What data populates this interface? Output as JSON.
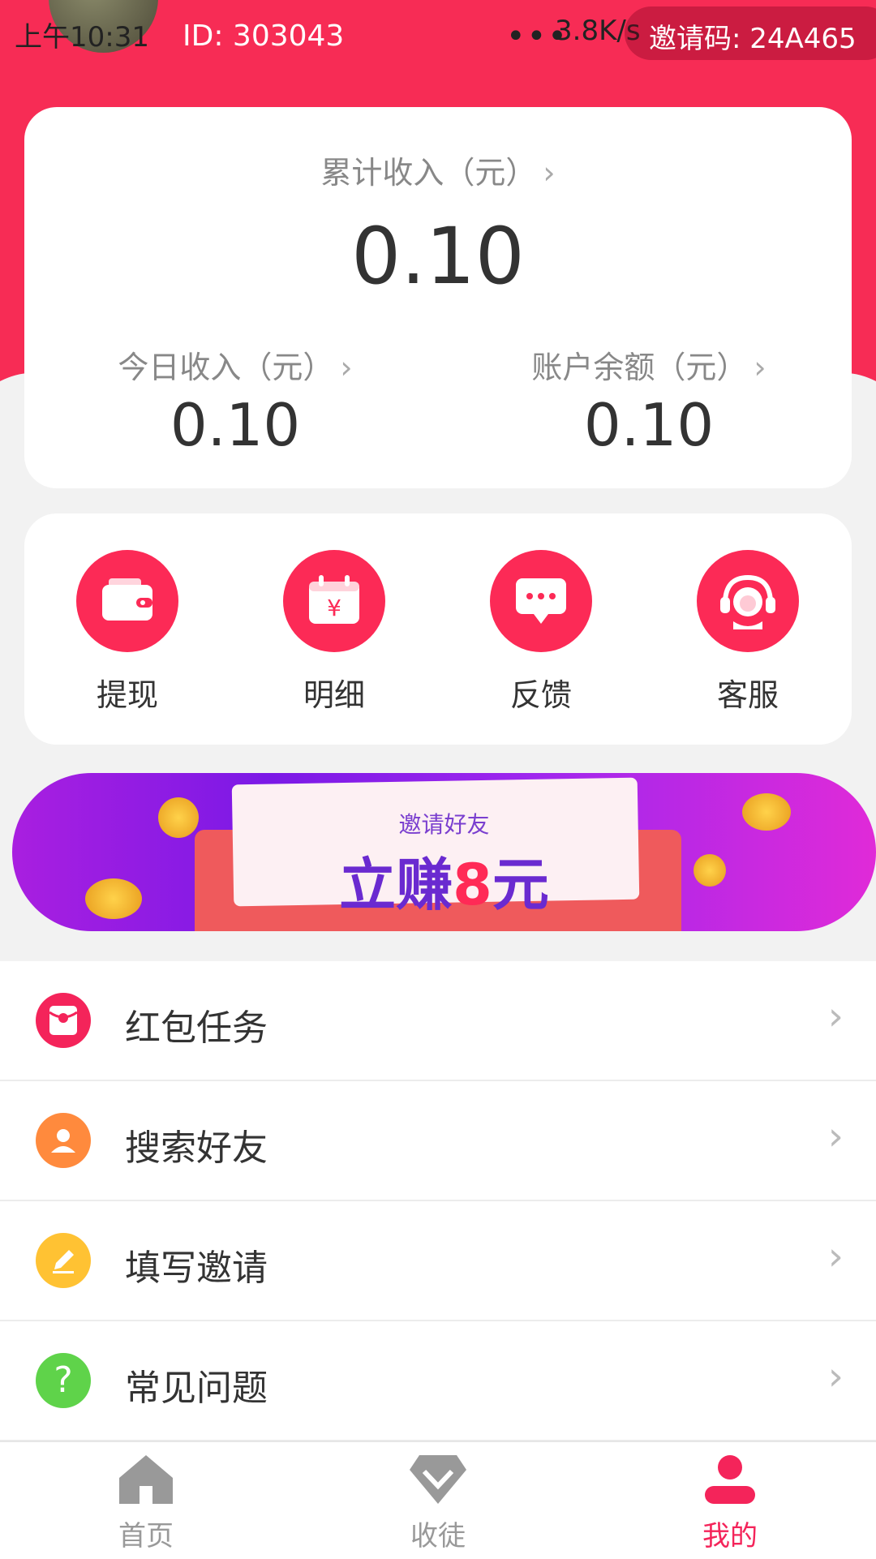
{
  "status_bar": {
    "time": "上午10:31",
    "network_speed": "3.8K/s"
  },
  "user": {
    "id_text": "ID: 303043",
    "invite_code_text": "邀请码: 24A465"
  },
  "earnings": {
    "total_label": "累计收入（元）",
    "total_value": "0.10",
    "today_label": "今日收入（元）",
    "today_value": "0.10",
    "balance_label": "账户余额（元）",
    "balance_value": "0.10"
  },
  "quick_actions": [
    {
      "label": "提现",
      "icon": "wallet-icon"
    },
    {
      "label": "明细",
      "icon": "calendar-yen-icon"
    },
    {
      "label": "反馈",
      "icon": "chat-bubble-icon"
    },
    {
      "label": "客服",
      "icon": "headset-icon"
    }
  ],
  "banner": {
    "subtitle": "邀请好友",
    "title_prefix": "立赚",
    "title_number": "8",
    "title_suffix": "元"
  },
  "menu": [
    {
      "label": "红包任务",
      "icon": "red-packet-icon",
      "color": "#f4245a"
    },
    {
      "label": "搜索好友",
      "icon": "person-icon",
      "color": "#ff8a3d"
    },
    {
      "label": "填写邀请",
      "icon": "pencil-icon",
      "color": "#ffc233"
    },
    {
      "label": "常见问题",
      "icon": "question-icon",
      "color": "#5fd34a"
    }
  ],
  "tabbar": [
    {
      "label": "首页",
      "icon": "home-icon",
      "active": false
    },
    {
      "label": "收徒",
      "icon": "diamond-icon",
      "active": false
    },
    {
      "label": "我的",
      "icon": "user-icon",
      "active": true
    }
  ],
  "colors": {
    "primary": "#f4245a",
    "inactive": "#999999"
  }
}
